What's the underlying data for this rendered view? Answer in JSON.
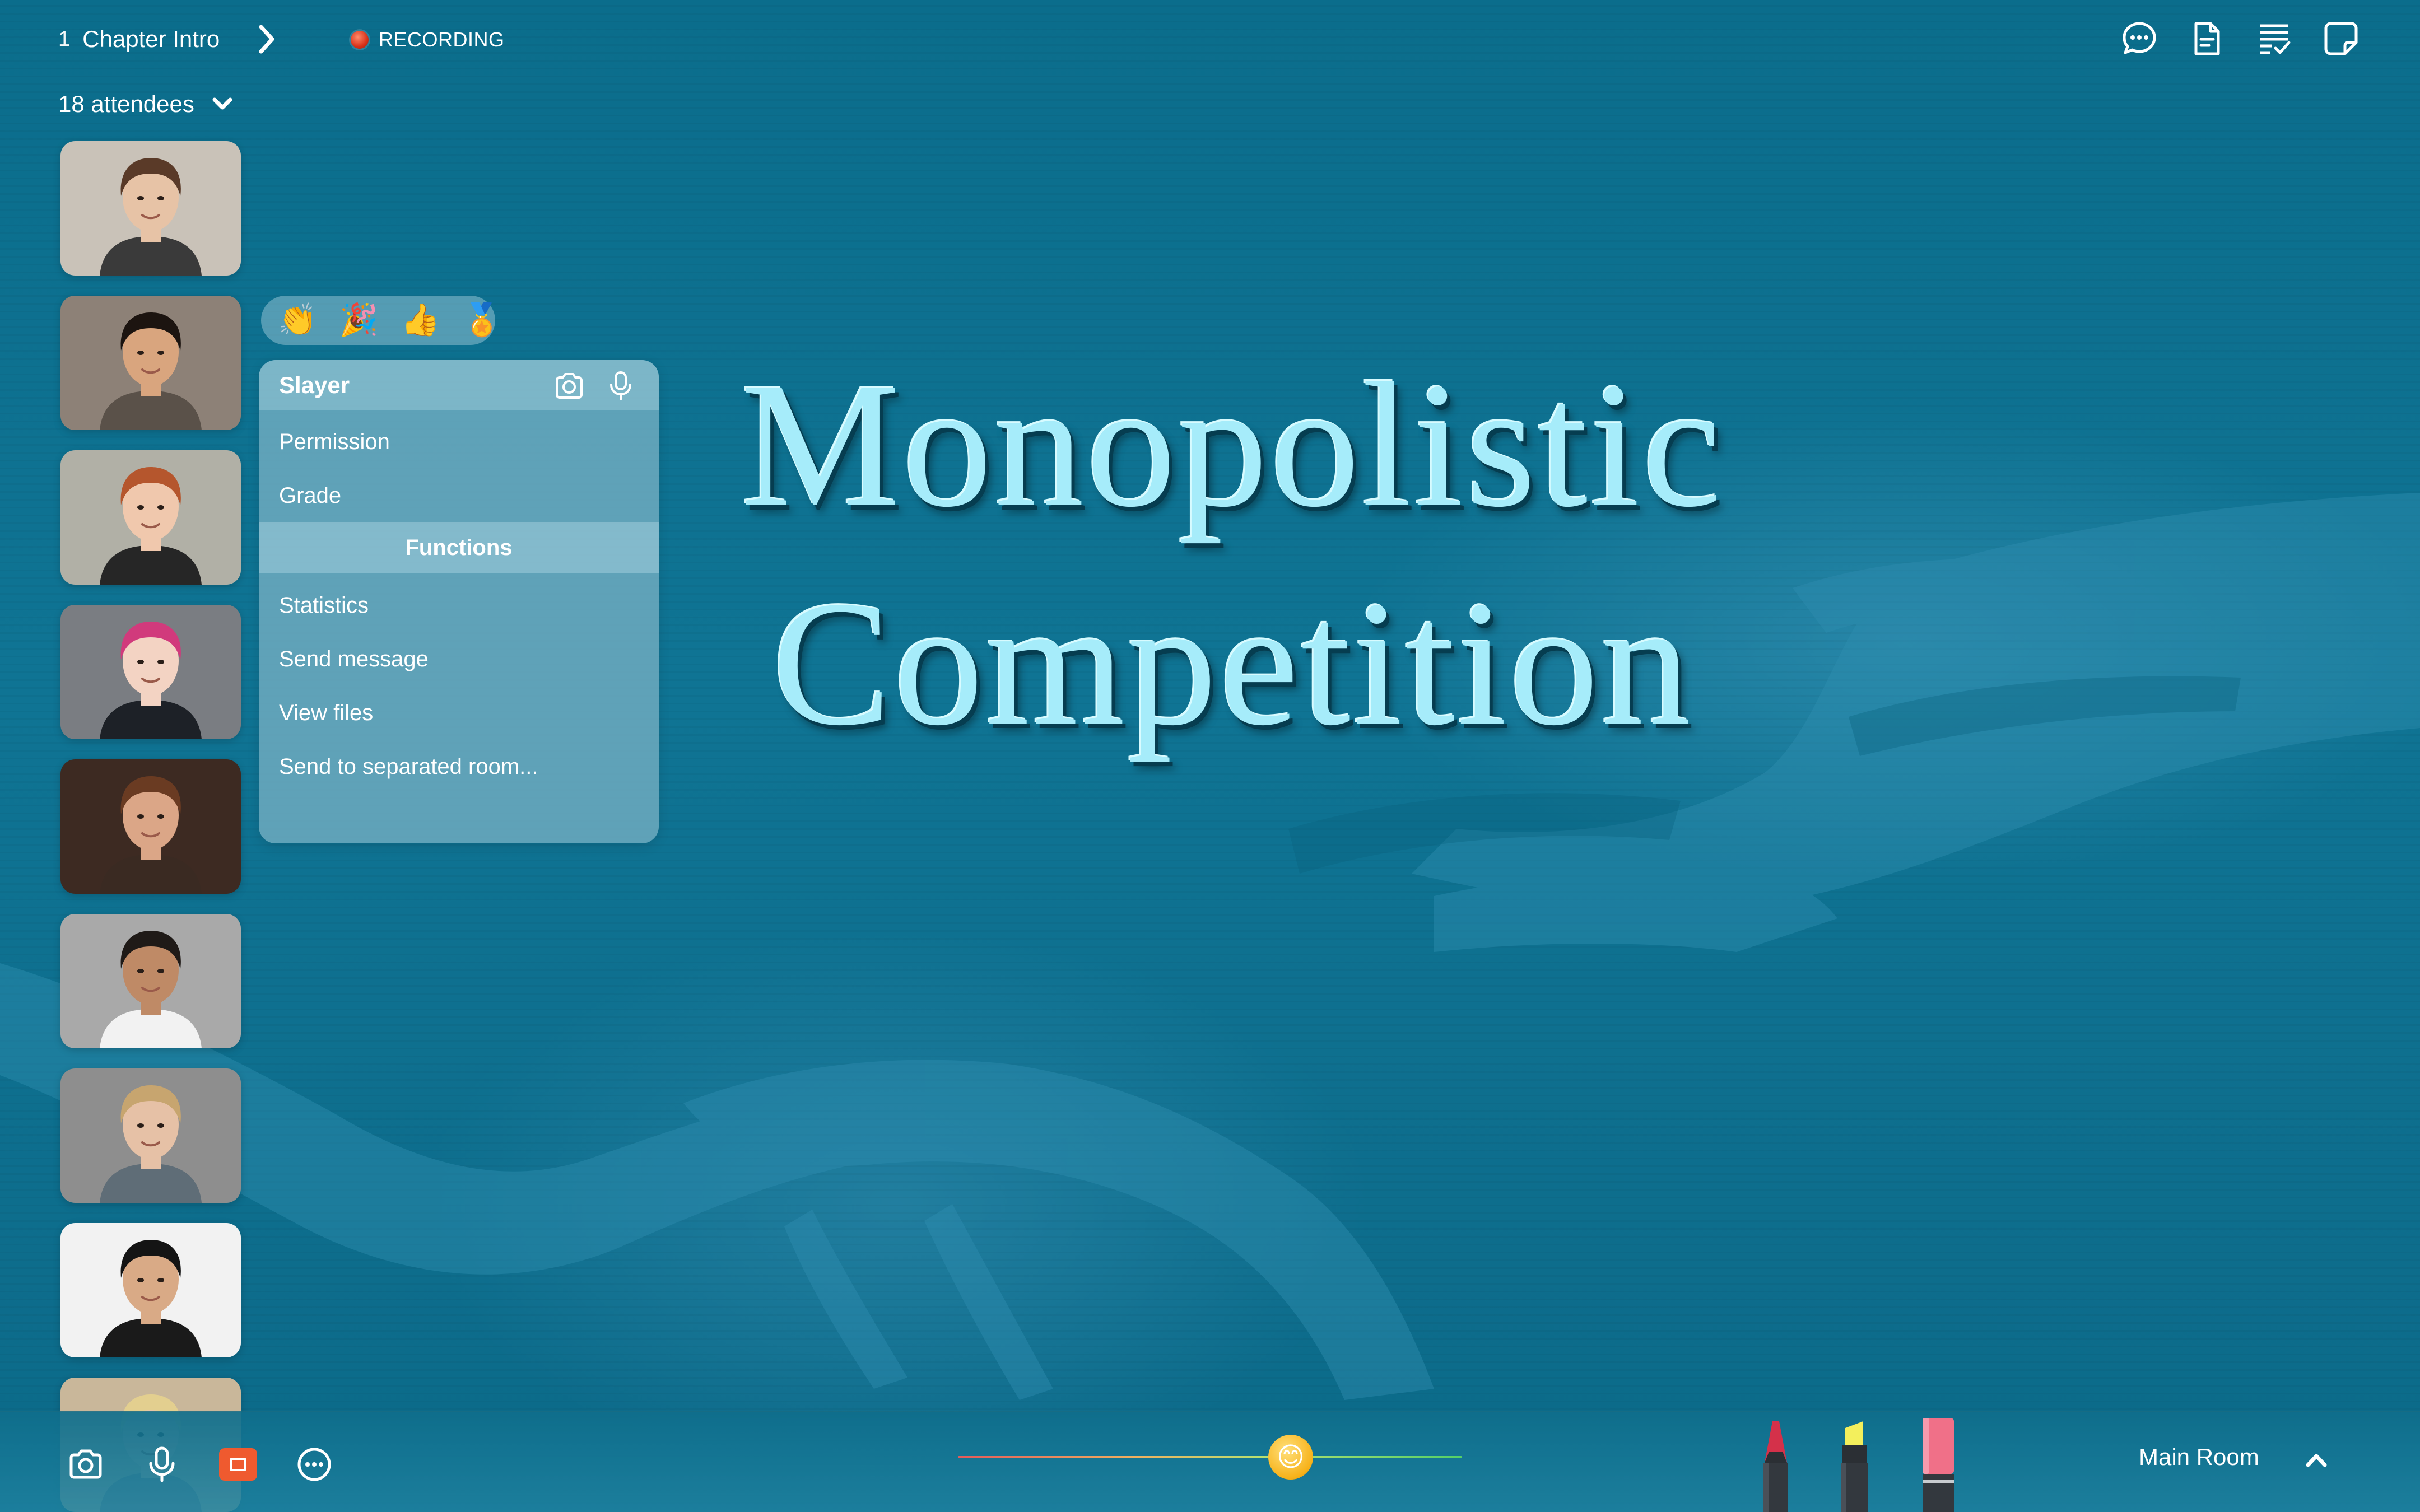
{
  "header": {
    "chapter_number": "1",
    "chapter_title": "Chapter Intro",
    "recording_label": "RECORDING",
    "attendees_label": "18 attendees"
  },
  "top_icons": [
    "chat-icon",
    "document-icon",
    "checklist-icon",
    "note-icon"
  ],
  "attendees": [
    {
      "tone": "#c9c2b8",
      "skin": "#e7c3a6",
      "hair": "#5a3a28",
      "shirt": "#3a3a3a"
    },
    {
      "tone": "#8d8177",
      "skin": "#d9a57e",
      "hair": "#1c1410",
      "shirt": "#5a5149"
    },
    {
      "tone": "#b1b0a6",
      "skin": "#f0c8ad",
      "hair": "#b5562d",
      "shirt": "#262626"
    },
    {
      "tone": "#7a7d82",
      "skin": "#f3d3c3",
      "hair": "#d13a7c",
      "shirt": "#1d2127"
    },
    {
      "tone": "#3d2a22",
      "skin": "#dba687",
      "hair": "#6a3b22",
      "shirt": "#3a2a22"
    },
    {
      "tone": "#a9a9a9",
      "skin": "#bf8a66",
      "hair": "#1f1a17",
      "shirt": "#f2f2f2"
    },
    {
      "tone": "#8e8e8e",
      "skin": "#e6c1a6",
      "hair": "#c7a56f",
      "shirt": "#5f6d77"
    },
    {
      "tone": "#f2f2f2",
      "skin": "#d9aa86",
      "hair": "#141414",
      "shirt": "#1a1a1a"
    },
    {
      "tone": "#c9b79a",
      "skin": "#e8c6aa",
      "hair": "#e3cf8f",
      "shirt": "#888888"
    }
  ],
  "reactions": [
    "👏",
    "🎉",
    "👍",
    "🏅"
  ],
  "menu": {
    "user": "Slayer",
    "items_top": [
      "Permission",
      "Grade"
    ],
    "section": "Functions",
    "items_bottom": [
      "Statistics",
      "Send message",
      "View files",
      "Send to separated room..."
    ]
  },
  "slide": {
    "line1": "Monopolistic",
    "line2": "Competition"
  },
  "bottom": {
    "emoji": "😊",
    "slider_fraction": 0.66,
    "room_label": "Main Room"
  },
  "pens": [
    {
      "name": "red-pen",
      "color": "#d4314a"
    },
    {
      "name": "yellow-highlighter",
      "color": "#f3ef5c"
    },
    {
      "name": "pink-marker",
      "color": "#f07088"
    }
  ]
}
